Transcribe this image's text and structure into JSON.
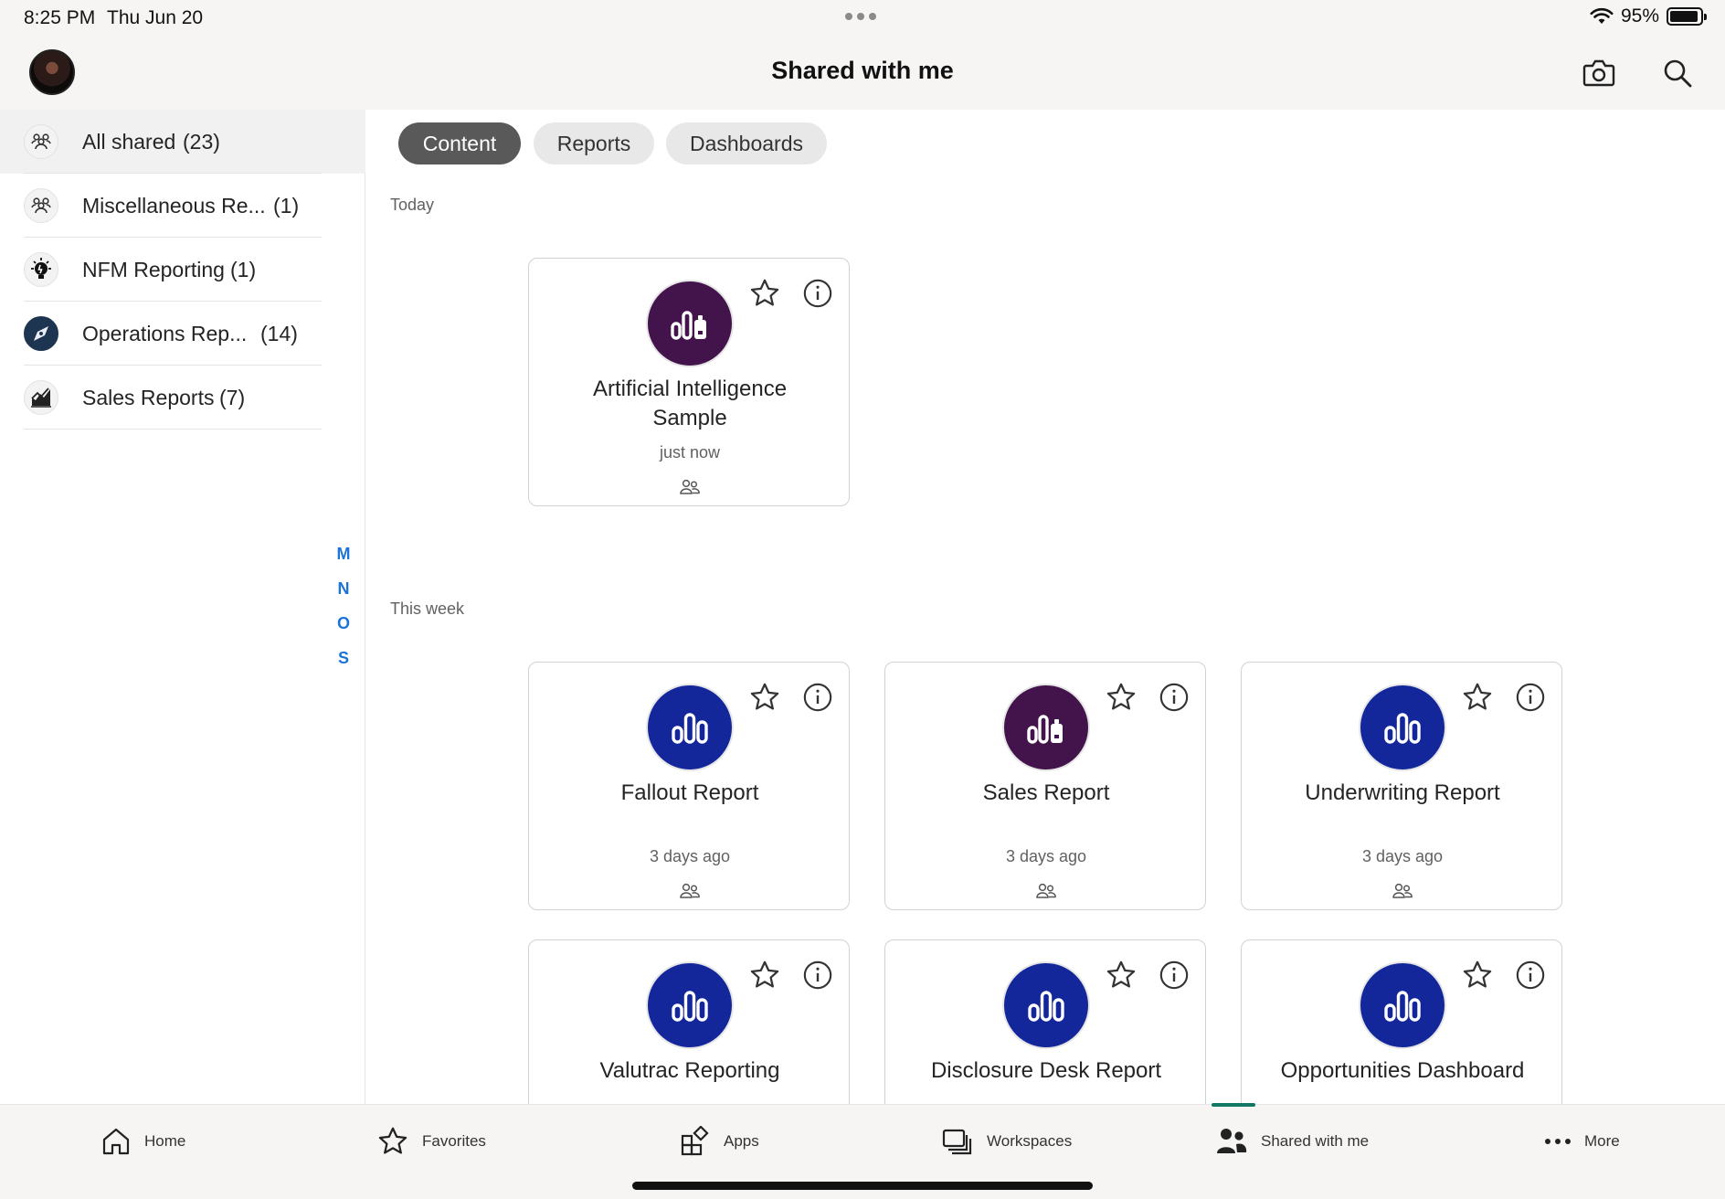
{
  "status_bar": {
    "time": "8:25 PM",
    "date": "Thu Jun 20",
    "battery": "95%",
    "battery_level": 0.95
  },
  "header": {
    "title": "Shared with me",
    "camera_icon": "camera-icon",
    "search_icon": "search-icon"
  },
  "sidebar": {
    "items": [
      {
        "label": "All shared",
        "count": "(23)",
        "icon": "people-group-icon"
      },
      {
        "label": "Miscellaneous Re...",
        "count": "(1)",
        "icon": "people-group-icon"
      },
      {
        "label": "NFM Reporting",
        "count": "(1)",
        "icon": "lightbulb-gear-icon"
      },
      {
        "label": "Operations Rep...",
        "count": "(14)",
        "icon": "compass-logo-icon"
      },
      {
        "label": "Sales Reports",
        "count": "(7)",
        "icon": "chart-trend-icon"
      }
    ],
    "index_letters": [
      "M",
      "N",
      "O",
      "S"
    ]
  },
  "tabs": [
    "Content",
    "Reports",
    "Dashboards"
  ],
  "sections": {
    "today": {
      "label": "Today",
      "cards": [
        {
          "title_line1": "Artificial Intelligence",
          "title_line2": "Sample",
          "time": "just now"
        }
      ]
    },
    "this_week": {
      "label": "This week",
      "cards": [
        {
          "title": "Fallout Report",
          "time": "3 days ago"
        },
        {
          "title": "Sales Report",
          "time": "3 days ago"
        },
        {
          "title": "Underwriting Report",
          "time": "3 days ago"
        },
        {
          "title": "Valutrac Reporting",
          "time": ""
        },
        {
          "title": "Disclosure Desk Report",
          "time": ""
        },
        {
          "title": "Opportunities Dashboard",
          "time": ""
        }
      ]
    }
  },
  "bottom_nav": [
    "Home",
    "Favorites",
    "Apps",
    "Workspaces",
    "Shared with me",
    "More"
  ],
  "colors": {
    "accent": "#117865",
    "report_blue": "#13279b",
    "report_purple": "#43134b",
    "index_blue": "#1a73d9"
  }
}
